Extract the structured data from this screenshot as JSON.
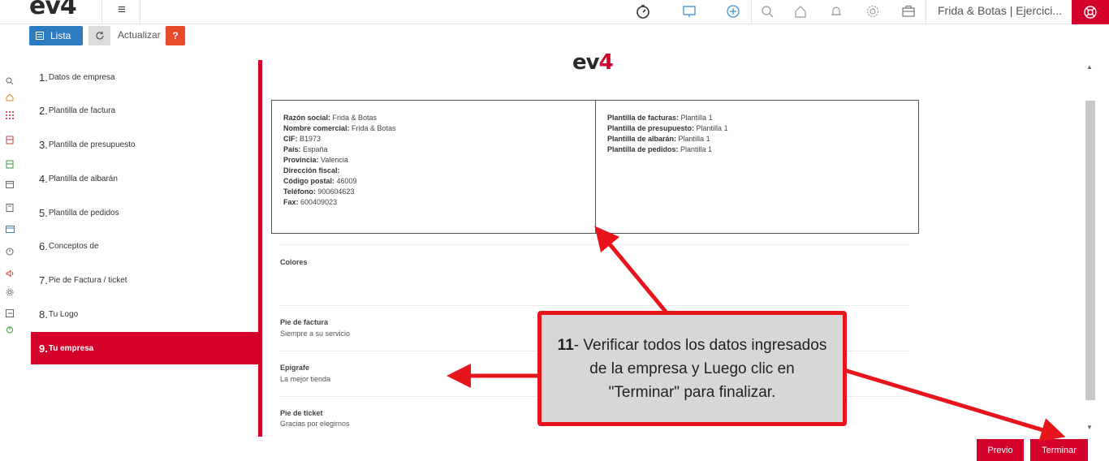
{
  "header": {
    "logo_main": "ev",
    "logo_four": "4",
    "menu_glyph": "≡",
    "company": "Frida & Botas | Ejercici...",
    "icons": [
      "timer-icon",
      "monitor-icon",
      "plus-circle-icon",
      "search-icon",
      "home-icon",
      "bell-icon",
      "gear-icon",
      "briefcase-icon",
      "lifebuoy-icon"
    ]
  },
  "toolbar": {
    "lista_label": "Lista",
    "actualizar_label": "Actualizar",
    "help_label": "?"
  },
  "steps": [
    {
      "num": "1.",
      "label": "Datos de empresa"
    },
    {
      "num": "2.",
      "label": "Plantilla de factura"
    },
    {
      "num": "3.",
      "label": "Plantilla de presupuesto"
    },
    {
      "num": "4.",
      "label": "Plantilla de albarán"
    },
    {
      "num": "5.",
      "label": "Plantilla de pedidos"
    },
    {
      "num": "6.",
      "label": "Conceptos de"
    },
    {
      "num": "7.",
      "label": "Pie de Factura / ticket"
    },
    {
      "num": "8.",
      "label": "Tu Logo"
    },
    {
      "num": "9.",
      "label": "Tu empresa",
      "active": true
    }
  ],
  "summary": {
    "logo_main": "ev",
    "logo_four": "4",
    "left": [
      {
        "label": "Razón social:",
        "value": "Frida & Botas"
      },
      {
        "label": "Nombre comercial:",
        "value": "Frida & Botas"
      },
      {
        "label": "CIF:",
        "value": "B1973"
      },
      {
        "label": "País:",
        "value": "España"
      },
      {
        "label": "Provincia:",
        "value": "Valencia"
      },
      {
        "label": "Dirección fiscal:",
        "value": ""
      },
      {
        "label": "Código postal:",
        "value": "46009"
      },
      {
        "label": "Teléfono:",
        "value": "900604623"
      },
      {
        "label": "Fax:",
        "value": "600409023"
      }
    ],
    "right": [
      {
        "label": "Plantilla de facturas:",
        "value": "Plantilla 1"
      },
      {
        "label": "Plantilla de presupuesto:",
        "value": "Plantilla 1"
      },
      {
        "label": "Plantilla de albarán:",
        "value": "Plantilla 1"
      },
      {
        "label": "Plantilla de pedidos:",
        "value": "Plantilla 1"
      }
    ],
    "colores_title": "Colores",
    "pie_factura_title": "Pie de factura",
    "pie_factura_value": "Siempre a su servicio",
    "epigrafe_title": "Epigrafe",
    "epigrafe_value": "La mejor tienda",
    "pie_ticket_title": "Pie de ticket",
    "pie_ticket_value": "Gracias por elegirnos"
  },
  "footer": {
    "previo_label": "Previo",
    "terminar_label": "Terminar"
  },
  "callout": {
    "step_number": "11",
    "text": "- Verificar todos los datos ingresados de la empresa y Luego clic en \"Terminar\" para finalizar."
  },
  "colors": {
    "accent_red": "#d4002c",
    "primary_blue": "#2d7cc2",
    "callout_bg": "#d7d7d7",
    "arrow_red": "#e8141c"
  }
}
